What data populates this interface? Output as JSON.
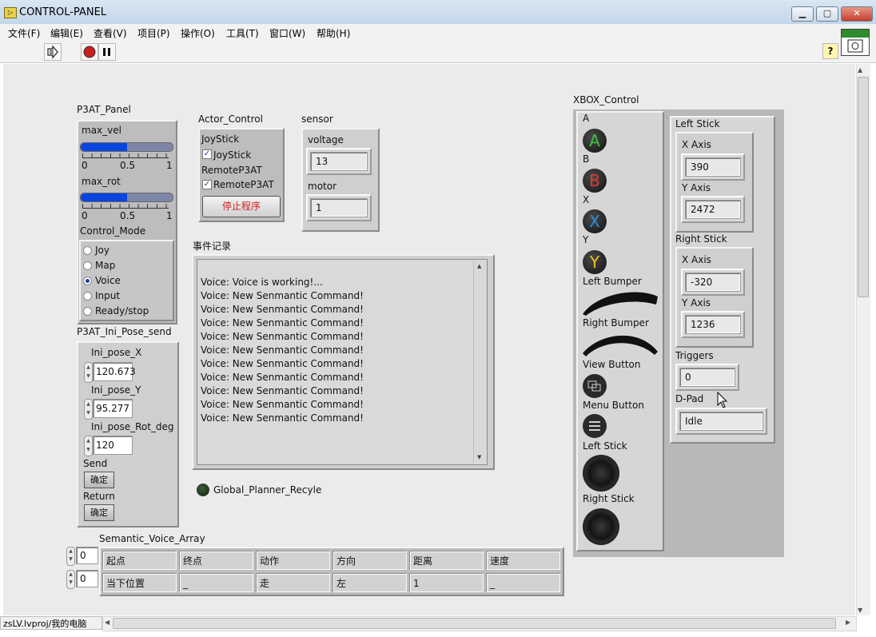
{
  "window": {
    "title": "CONTROL-PANEL",
    "icon_text": "▷"
  },
  "menu": [
    "文件(F)",
    "编辑(E)",
    "查看(V)",
    "项目(P)",
    "操作(O)",
    "工具(T)",
    "窗口(W)",
    "帮助(H)"
  ],
  "toolbar": {
    "help_label": "?"
  },
  "p3at_panel": {
    "title": "P3AT_Panel",
    "max_vel": {
      "label": "max_vel",
      "value": 0.5,
      "ticks": [
        "0",
        "0.5",
        "1"
      ]
    },
    "max_rot": {
      "label": "max_rot",
      "value": 0.5,
      "ticks": [
        "0",
        "0.5",
        "1"
      ]
    },
    "control_mode": {
      "label": "Control_Mode",
      "options": [
        "Joy",
        "Map",
        "Voice",
        "Input",
        "Ready/stop"
      ],
      "selected": "Voice"
    }
  },
  "actor_control": {
    "title": "Actor_Control",
    "joystick_label": "JoyStick",
    "joystick_check": "JoyStick",
    "remote_label": "RemoteP3AT",
    "remote_check": "RemoteP3AT",
    "stop_button": "停止程序"
  },
  "sensor": {
    "title": "sensor",
    "voltage_label": "voltage",
    "voltage": "13",
    "motor_label": "motor",
    "motor": "1"
  },
  "event_log": {
    "title": "事件记录",
    "lines": [
      "Voice: Voice is working!...",
      "Voice: New Senmantic Command!",
      "Voice: New Senmantic Command!",
      "Voice: New Senmantic Command!",
      "Voice: New Senmantic Command!",
      "Voice: New Senmantic Command!",
      "Voice: New Senmantic Command!",
      "Voice: New Senmantic Command!",
      "Voice: New Senmantic Command!",
      "Voice: New Senmantic Command!",
      "Voice: New Senmantic Command!"
    ]
  },
  "global_planner": {
    "label": "Global_Planner_Recyle"
  },
  "ini_pose": {
    "title": "P3AT_Ini_Pose_send",
    "x_label": "Ini_pose_X",
    "x": "120.673",
    "y_label": "Ini_pose_Y",
    "y": "95.277",
    "rot_label": "Ini_pose_Rot_deg",
    "rot": "120",
    "send_label": "Send",
    "send_button": "确定",
    "return_label": "Return",
    "return_button": "确定"
  },
  "semantic_array": {
    "title": "Semantic_Voice_Array",
    "index_row": "0",
    "index_col": "0",
    "headers": [
      "起点",
      "终点",
      "动作",
      "方向",
      "距离",
      "速度"
    ],
    "values": [
      "当下位置",
      "_",
      "走",
      "左",
      "1",
      "_"
    ]
  },
  "xbox": {
    "title": "XBOX_Control",
    "buttons": {
      "a": "A",
      "b": "B",
      "x": "X",
      "y": "Y"
    },
    "button_glyphs": {
      "a": "A",
      "b": "B",
      "x": "X",
      "y": "Y"
    },
    "labels": {
      "left_bumper": "Left Bumper",
      "right_bumper": "Right Bumper",
      "view": "View Button",
      "menu": "Menu Button",
      "left_stick": "Left Stick",
      "right_stick": "Right Stick"
    },
    "left_stick": {
      "title": "Left Stick",
      "x_label": "X Axis",
      "x": "390",
      "y_label": "Y Axis",
      "y": "2472"
    },
    "right_stick": {
      "title": "Right Stick",
      "x_label": "X Axis",
      "x": "-320",
      "y_label": "Y Axis",
      "y": "1236"
    },
    "triggers": {
      "label": "Triggers",
      "value": "0"
    },
    "dpad": {
      "label": "D-Pad",
      "value": "Idle"
    },
    "colors": {
      "a": "#3fbf3f",
      "b": "#e03a2e",
      "x": "#2a8fe0",
      "y": "#f0c020"
    }
  },
  "status": {
    "project": "zsLV.lvproj/我的电脑"
  }
}
